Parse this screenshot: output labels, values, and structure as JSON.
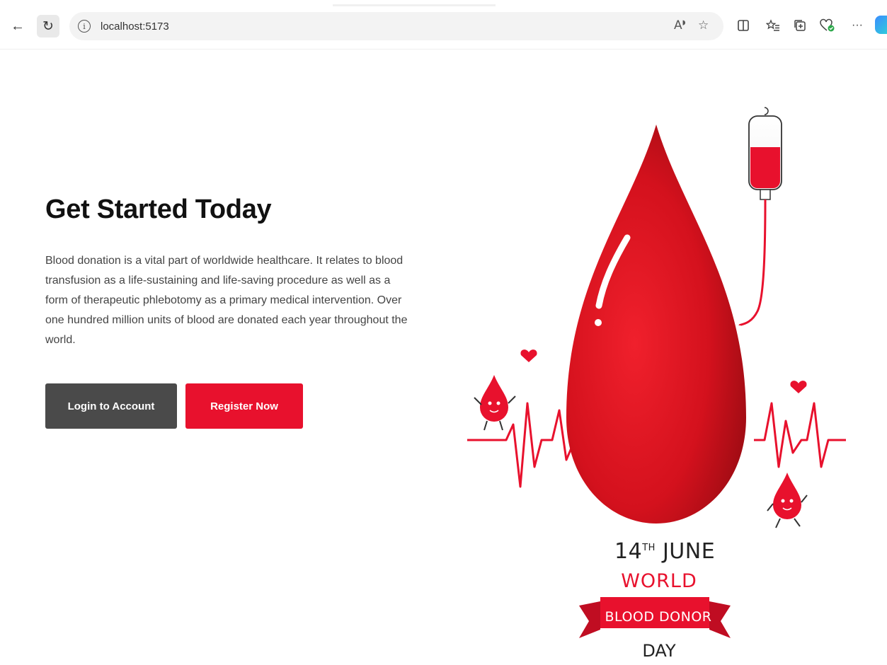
{
  "browser": {
    "url": "localhost:5173",
    "back_icon": "back-arrow-icon",
    "reload_icon": "reload-icon",
    "info_icon": "info-icon",
    "read_aloud_icon": "read-aloud-icon",
    "favorite_icon": "star-icon",
    "split_icon": "split-screen-icon",
    "favorites_icon": "favorites-list-icon",
    "collections_icon": "collections-icon",
    "health_icon": "browser-essentials-icon",
    "more_icon": "more-icon",
    "copilot_icon": "copilot-icon"
  },
  "hero": {
    "title": "Get Started Today",
    "description": "Blood donation is a vital part of worldwide healthcare. It relates to blood transfusion as a life-sustaining and life-saving procedure as well as a form of therapeutic phlebotomy as a primary medical intervention. Over one hundred million units of blood are donated each year throughout the world.",
    "login_label": "Login to Account",
    "register_label": "Register Now"
  },
  "illustration": {
    "date_number": "14",
    "date_suffix": "TH",
    "date_month": "JUNE",
    "line1": "WORLD",
    "ribbon": "BLOOD DONOR",
    "line3": "DAY"
  },
  "colors": {
    "brand_red": "#e8112d",
    "login_gray": "#4a4a4a"
  }
}
